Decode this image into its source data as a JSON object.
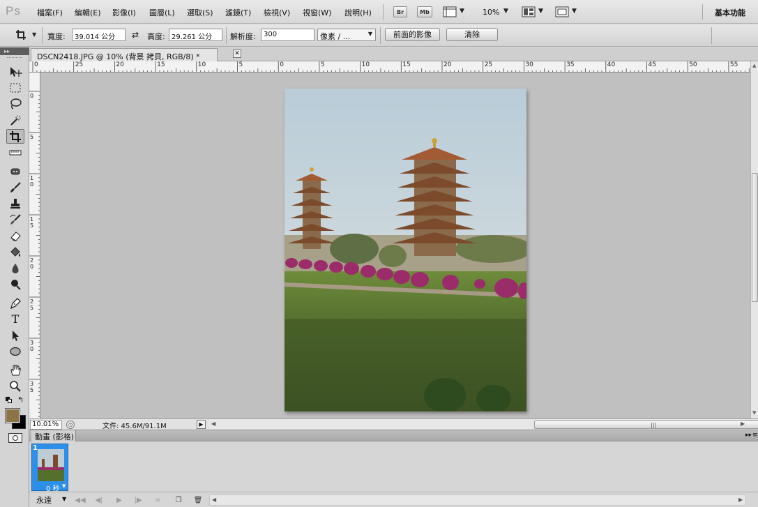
{
  "app": {
    "logo": "Ps",
    "workspace_label": "基本功能"
  },
  "menu": [
    {
      "label": "檔案(F)"
    },
    {
      "label": "編輯(E)"
    },
    {
      "label": "影像(I)"
    },
    {
      "label": "圖層(L)"
    },
    {
      "label": "選取(S)"
    },
    {
      "label": "濾鏡(T)"
    },
    {
      "label": "檢視(V)"
    },
    {
      "label": "視窗(W)"
    },
    {
      "label": "說明(H)"
    }
  ],
  "app_toolbar": {
    "bridge_label": "Br",
    "mini_bridge_label": "Mb",
    "zoom_value": "10%"
  },
  "options_bar": {
    "width_label": "寬度:",
    "width_value": "39.014 公分",
    "height_label": "高度:",
    "height_value": "29.261 公分",
    "resolution_label": "解析度:",
    "resolution_value": "300",
    "unit_value": "像素 / ...",
    "front_image_button": "前面的影像",
    "clear_button": "清除"
  },
  "document": {
    "tab_title": "DSCN2418.JPG @ 10% (背景 拷貝, RGB/8) *",
    "close_symbol": "✕"
  },
  "ruler": {
    "top_labels": [
      "0",
      "25",
      "20",
      "15",
      "10",
      "5",
      "0",
      "5",
      "10",
      "15",
      "20",
      "25",
      "30",
      "35",
      "40",
      "45",
      "50",
      "55"
    ],
    "left_labels": [
      "0",
      "5",
      "10",
      "15",
      "20",
      "25",
      "30",
      "35"
    ]
  },
  "status": {
    "zoom": "10.01%",
    "file_info": "文件: 45.6M/91.1M"
  },
  "animation_panel": {
    "tab_label": "動畫 (影格)",
    "frames": [
      {
        "number": "1",
        "delay": "0 秒"
      }
    ],
    "loop_value": "永遠"
  },
  "colors": {
    "accent": "#2d8fe8",
    "foreground_swatch": "#8b7445",
    "background_swatch": "#000000"
  },
  "icons": [
    "move-icon",
    "marquee-icon",
    "lasso-icon",
    "quick-select-icon",
    "crop-icon",
    "ruler-icon",
    "healing-icon",
    "brush-icon",
    "stamp-icon",
    "history-brush-icon",
    "eraser-icon",
    "paint-bucket-icon",
    "blur-icon",
    "dodge-icon",
    "pen-icon",
    "type-icon",
    "path-select-icon",
    "ellipse-icon",
    "hand-icon",
    "zoom-icon"
  ]
}
